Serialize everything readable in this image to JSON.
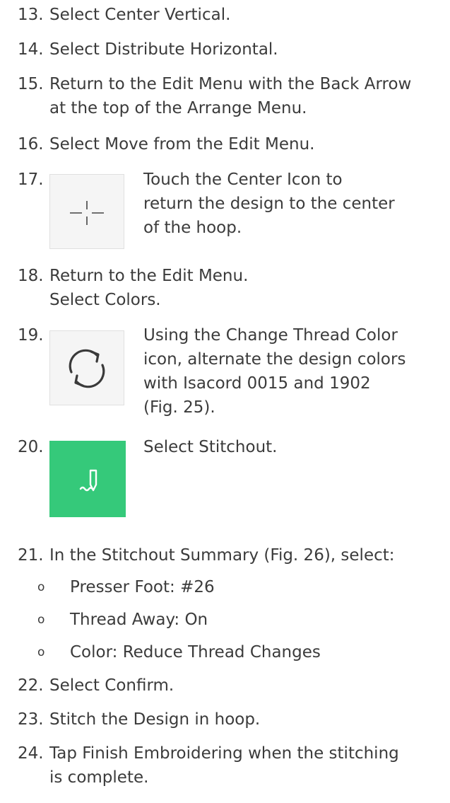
{
  "steps": {
    "s13": {
      "num": "13.",
      "lines": [
        "Select Center Vertical."
      ]
    },
    "s14": {
      "num": "14.",
      "lines": [
        "Select Distribute Horizontal."
      ]
    },
    "s15": {
      "num": "15.",
      "lines": [
        "Return to the Edit Menu with the Back Arrow",
        "at the top of the Arrange Menu."
      ]
    },
    "s16": {
      "num": "16.",
      "lines": [
        "Select Move from the Edit Menu."
      ]
    },
    "s17": {
      "num": "17.",
      "icon": "center-crosshair-icon",
      "lines": [
        "Touch the Center Icon to",
        "return the design to the center",
        "of the hoop."
      ]
    },
    "s18": {
      "num": "18.",
      "lines": [
        "Return to the Edit Menu.",
        "Select Colors."
      ]
    },
    "s19": {
      "num": "19.",
      "icon": "change-thread-color-icon",
      "lines": [
        "Using the Change Thread Color",
        "icon, alternate the design colors",
        "with Isacord 0015 and 1902",
        "(Fig. 25)."
      ]
    },
    "s20": {
      "num": "20.",
      "icon": "stitchout-needle-icon",
      "lines": [
        "Select Stitchout."
      ]
    },
    "s21": {
      "num": "21.",
      "lines": [
        "In the Stitchout Summary (Fig. 26), select:"
      ]
    },
    "s22": {
      "num": "22.",
      "lines": [
        "Select Confirm."
      ]
    },
    "s23": {
      "num": "23.",
      "lines": [
        "Stitch the Design in hoop."
      ]
    },
    "s24": {
      "num": "24.",
      "lines": [
        "Tap Finish Embroidering when the stitching",
        "is complete."
      ]
    }
  },
  "bullets": {
    "marker": "o",
    "items": [
      "Presser Foot: #26",
      "Thread Away: On",
      "Color: Reduce Thread Changes"
    ]
  },
  "colors": {
    "text": "#3b3b3b",
    "icon_box_bg": "#f5f5f5",
    "stitchout_green": "#35c97a"
  }
}
